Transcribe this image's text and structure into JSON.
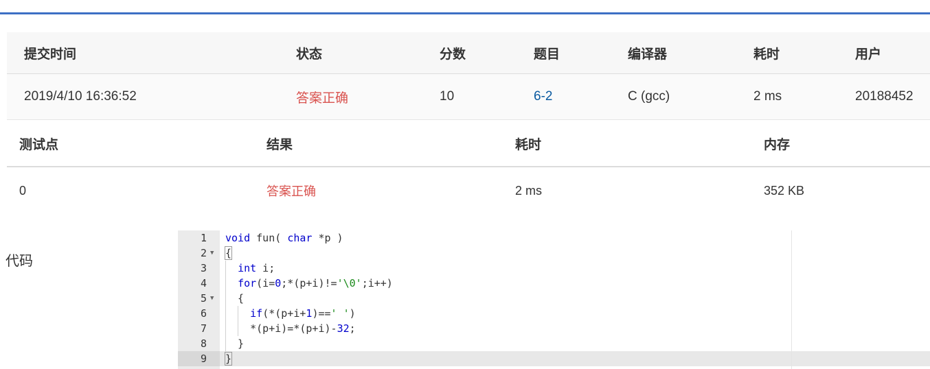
{
  "submission": {
    "headers": {
      "time": "提交时间",
      "status": "状态",
      "score": "分数",
      "problem": "题目",
      "compiler": "编译器",
      "elapsed": "耗时",
      "user": "用户"
    },
    "row": {
      "time": "2019/4/10 16:36:52",
      "status": "答案正确",
      "score": "10",
      "problem": "6-2",
      "compiler": "C (gcc)",
      "elapsed": "2 ms",
      "user": "20188452"
    }
  },
  "testcases": {
    "headers": {
      "case": "测试点",
      "result": "结果",
      "elapsed": "耗时",
      "memory": "内存"
    },
    "rows": [
      {
        "case": "0",
        "result": "答案正确",
        "elapsed": "2 ms",
        "memory": "352 KB"
      }
    ]
  },
  "code": {
    "label": "代码",
    "lines": [
      {
        "n": "1",
        "text": "void fun( char *p )"
      },
      {
        "n": "2",
        "text": "{"
      },
      {
        "n": "3",
        "text": "  int i;"
      },
      {
        "n": "4",
        "text": "  for(i=0;*(p+i)!='\\0';i++)"
      },
      {
        "n": "5",
        "text": "  {"
      },
      {
        "n": "6",
        "text": "    if(*(p+i+1)==' ')"
      },
      {
        "n": "7",
        "text": "    *(p+i)=*(p+i)-32;"
      },
      {
        "n": "8",
        "text": "  }"
      },
      {
        "n": "9",
        "text": "}"
      }
    ]
  },
  "colors": {
    "accent": "#3d6fc4",
    "status_ok": "#d9534f",
    "link": "#0a5aa0"
  }
}
